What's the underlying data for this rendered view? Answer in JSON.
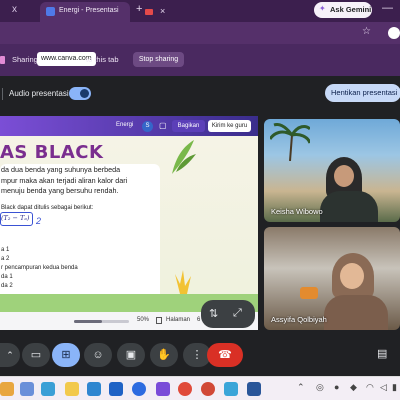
{
  "browser": {
    "tab_prev_close": "x",
    "tab_title": "Energi - Presentasi",
    "tab_close": "×",
    "new_tab": "+",
    "gemini_label": "Ask Gemini",
    "minimize": "—"
  },
  "share_bar": {
    "sharing_label": "Sharing",
    "url": "www.canva.com",
    "to_tab": "to this tab",
    "stop_sharing": "Stop sharing"
  },
  "meet": {
    "audio_label": "Audio presentasi",
    "stop_presenting": "Hentikan presentasi"
  },
  "canva": {
    "doc_title": "Energi",
    "user_initial": "S",
    "share_label": "Bagikan",
    "send_to_teacher": "Kirim ke guru",
    "slide_title": "AS BLACK",
    "paragraph_1": "da dua benda yang suhunya berbeda",
    "paragraph_2": "mpur maka akan terjadi aliran kalor dari",
    "paragraph_3": "menuju benda yang bersuhu rendah.",
    "subhead": "Black dapat ditulis sebagai berikut:",
    "formula": "(T₂ − Tₐ)",
    "hand_number": "2",
    "list_items": [
      "a 1",
      "a 2",
      "r pencampuran kedua benda",
      "da 1",
      "da 2"
    ],
    "zoom_value": "50%",
    "zoom_fraction": 0.5,
    "page_label": "Halaman",
    "page_num": "6"
  },
  "participants": [
    {
      "name": "Keisha Wibowo"
    },
    {
      "name": "Assyifa Qolbiyah"
    }
  ],
  "colors": {
    "chrome_tabstrip": "#3c1f4e",
    "share_bar": "#4a2960",
    "meet_bg": "#202124",
    "end_call": "#d93025",
    "accent": "#8ab4f8"
  },
  "icons": {
    "camera": "camera-icon",
    "present": "present-icon",
    "emoji": "emoji-icon",
    "captions": "captions-icon",
    "raise_hand": "hand-icon",
    "end_call": "end-call-icon",
    "chat": "chat-icon"
  }
}
